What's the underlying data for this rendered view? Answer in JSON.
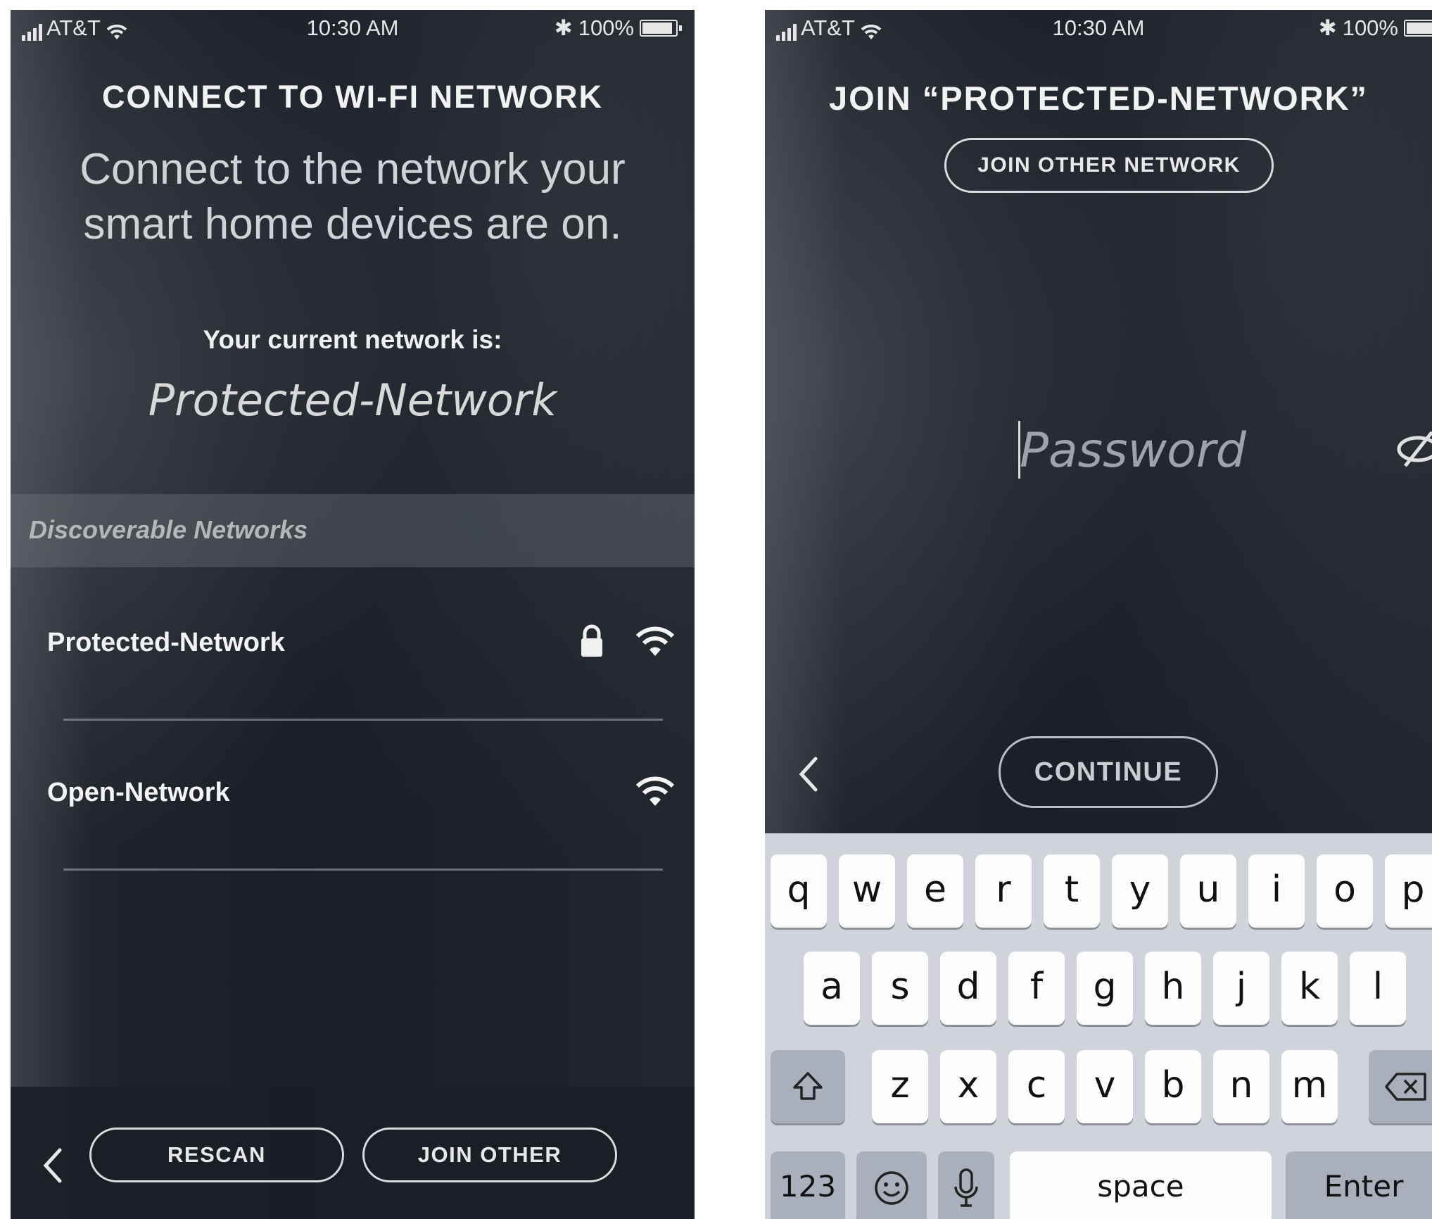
{
  "left_screen": {
    "status": {
      "carrier": "AT&T",
      "time": "10:30 AM",
      "battery": "100%"
    },
    "title": "CONNECT TO WI-FI NETWORK",
    "subtitle": "Connect to the network your smart home devices are on.",
    "current_label": "Your current network is:",
    "current_network": "Protected-Network",
    "section_header": "Discoverable Networks",
    "networks": [
      {
        "name": "Protected-Network",
        "locked": true
      },
      {
        "name": "Open-Network",
        "locked": false
      }
    ],
    "rescan_label": "RESCAN",
    "join_other_label": "JOIN OTHER"
  },
  "right_screen": {
    "status": {
      "carrier": "AT&T",
      "time": "10:30 AM",
      "battery": "100%"
    },
    "title": "JOIN “PROTECTED-NETWORK”",
    "join_other_network_label": "JOIN OTHER NETWORK",
    "password_placeholder": "Password",
    "continue_label": "CONTINUE",
    "keyboard": {
      "row1": [
        "q",
        "w",
        "e",
        "r",
        "t",
        "y",
        "u",
        "i",
        "o",
        "p"
      ],
      "row2": [
        "a",
        "s",
        "d",
        "f",
        "g",
        "h",
        "j",
        "k",
        "l"
      ],
      "row3": [
        "z",
        "x",
        "c",
        "v",
        "b",
        "n",
        "m"
      ],
      "numbers_key": "123",
      "space_key": "space",
      "enter_key": "Enter"
    }
  },
  "colors": {
    "background": "#1c2129",
    "text": "#f2f2f2",
    "keyboard": "#d0d3d9",
    "key": "#fdfdfe"
  }
}
